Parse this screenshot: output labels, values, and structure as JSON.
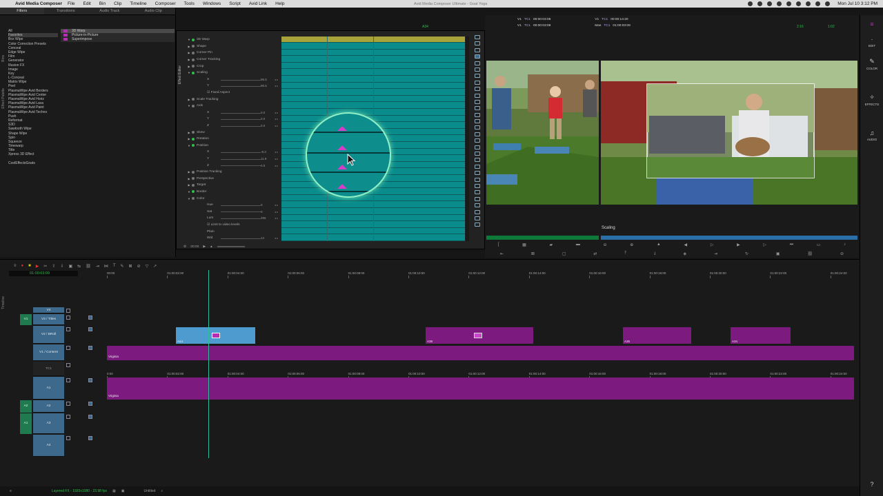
{
  "menubar": {
    "app": "Avid Media Composer",
    "items": [
      "File",
      "Edit",
      "Bin",
      "Clip",
      "Timeline",
      "Composer",
      "Tools",
      "Windows",
      "Script",
      "Avid Link",
      "Help"
    ],
    "window_title": "Avid Media Composer Ultimate - Goat Yoga",
    "clock": "Mon Jul 10  3:12 PM"
  },
  "palette": {
    "tabs": [
      "Filters",
      "Transitions",
      "Audio Track",
      "Audio Clip"
    ],
    "vtab_bins": "Bins",
    "vtab_effect_palette": "Effect Palette",
    "categories": [
      "All",
      "Favorites",
      "Box Wipe",
      "Color Correction Presets",
      "Conceal",
      "Edge Wipe",
      "Film",
      "Generator",
      "Illusion FX",
      "Image",
      "Key",
      "L-Conceal",
      "Matrix Wipe",
      "Peel",
      "PlasmaWipe Avid Borders",
      "PlasmaWipe Avid Center",
      "PlasmaWipe Avid Horiz",
      "PlasmaWipe Avid Lava",
      "PlasmaWipe Avid Paint",
      "PlasmaWipe Avid Techno",
      "Push",
      "Reformat",
      "S3D",
      "Sawtooth Wipe",
      "Shape Wipe",
      "Spin",
      "Squeeze",
      "Timewarp",
      "Title",
      "Xpress 3D Effect",
      "",
      "CoolEffectsGoats"
    ],
    "effects": [
      "3D Warp",
      "Picture-in-Picture",
      "Superimpose"
    ]
  },
  "editor": {
    "vtab": "Effect Editor",
    "effect_name": "3D Warp",
    "params": [
      {
        "tri": "▼",
        "label": "3D Warp",
        "dot": "g"
      },
      {
        "tri": "▶",
        "label": "Shape",
        "dot": ""
      },
      {
        "tri": "▶",
        "label": "Corner Pin",
        "dot": ""
      },
      {
        "tri": "▶",
        "label": "Corner Tracking",
        "dot": ""
      },
      {
        "tri": "▶",
        "label": "Crop",
        "dot": ""
      },
      {
        "tri": "▼",
        "label": "Scaling",
        "dot": "g"
      },
      {
        "tri": "",
        "label": "X",
        "dot": "",
        "val": "95.5"
      },
      {
        "tri": "",
        "label": "Y",
        "dot": "",
        "val": "95.5"
      },
      {
        "tri": "",
        "label": "☑ Fixed Aspect",
        "dot": ""
      },
      {
        "tri": "▶",
        "label": "Scale Tracking",
        "dot": ""
      },
      {
        "tri": "▼",
        "label": "Axis",
        "dot": ""
      },
      {
        "tri": "",
        "label": "X",
        "dot": "",
        "val": "0.0"
      },
      {
        "tri": "",
        "label": "Y",
        "dot": "",
        "val": "0.0"
      },
      {
        "tri": "",
        "label": "Z",
        "dot": "",
        "val": "0.0"
      },
      {
        "tri": "▶",
        "label": "Skew",
        "dot": ""
      },
      {
        "tri": "▶",
        "label": "Rotation",
        "dot": "g"
      },
      {
        "tri": "▼",
        "label": "Position",
        "dot": "g"
      },
      {
        "tri": "",
        "label": "X",
        "dot": "",
        "val": "-8.3"
      },
      {
        "tri": "",
        "label": "Y",
        "dot": "",
        "val": "11.9"
      },
      {
        "tri": "",
        "label": "Z",
        "dot": "",
        "val": "0.0"
      },
      {
        "tri": "▶",
        "label": "Position Tracking",
        "dot": ""
      },
      {
        "tri": "▶",
        "label": "Perspective",
        "dot": ""
      },
      {
        "tri": "▶",
        "label": "Target",
        "dot": ""
      },
      {
        "tri": "▼",
        "label": "Border",
        "dot": "g"
      },
      {
        "tri": "▼",
        "label": "Color",
        "dot": ""
      },
      {
        "tri": "",
        "label": "Hue",
        "dot": "",
        "val": "0"
      },
      {
        "tri": "",
        "label": "Sat",
        "dot": "",
        "val": "0"
      },
      {
        "tri": "",
        "label": "Lum",
        "dot": "",
        "val": "255"
      },
      {
        "tri": "",
        "label": "☑ Limit to video levels",
        "dot": ""
      },
      {
        "tri": "",
        "label": "Plain",
        "dot": ""
      },
      {
        "tri": "",
        "label": "Wid",
        "dot": "",
        "val": "14"
      }
    ],
    "timecode": "00:00"
  },
  "composer": {
    "info": [
      [
        "V1",
        "TC1",
        "00:00:03:08",
        "V1",
        "TC1",
        "00:00:14:20"
      ],
      [
        "V1",
        "TC1",
        "00:00:03:08",
        "Mas",
        "TC1",
        "01:00:03:09"
      ]
    ],
    "counters": [
      "2:16",
      "1:02"
    ],
    "src_marker": "A34",
    "scaling_label": "Scaling"
  },
  "dock": {
    "items": [
      "EDIT",
      "COLOR",
      "EFFECTS",
      "AUDIO"
    ]
  },
  "timeline": {
    "vtab": "Timeline",
    "master_tc": "01:00:03:09",
    "ruler_ticks": [
      "00:00",
      "01:00:02:00",
      "01:00:04:00",
      "01:00:06:00",
      "01:00:08:00",
      "01:00:10:00",
      "01:00:12:00",
      "01:00:14:00",
      "01:00:16:00",
      "01:00:18:00",
      "01:00:20:00",
      "01:00:22:00",
      "01:00:24:00"
    ],
    "ruler2_ticks": [
      "0:00",
      "01:00:02:00",
      "01:00:04:00",
      "01:00:06:00",
      "01:00:08:00",
      "01:00:10:00",
      "01:00:12:00",
      "01:00:14:00",
      "01:00:16:00",
      "01:00:18:00",
      "01:00:20:00",
      "01:00:22:00",
      "01:00:24:00"
    ],
    "tracks": [
      {
        "name": "V4"
      },
      {
        "name": "V3 / Titles"
      },
      {
        "name": "V2 / BRoll"
      },
      {
        "name": "V1 / Content"
      },
      {
        "name": "TC1"
      },
      {
        "name": "A1"
      },
      {
        "name": "A2"
      },
      {
        "name": "A3"
      },
      {
        "name": "A4"
      }
    ],
    "sources": [
      "V1",
      "A2",
      "A1"
    ],
    "clips": {
      "v2": [
        "A44",
        "A38",
        "A36",
        "A34"
      ],
      "v1": "Virginia",
      "a1": "Virginia"
    }
  },
  "status": {
    "format": "Layered FX - 1920x1080 - 23.98 fps",
    "seq": "Untitled"
  }
}
